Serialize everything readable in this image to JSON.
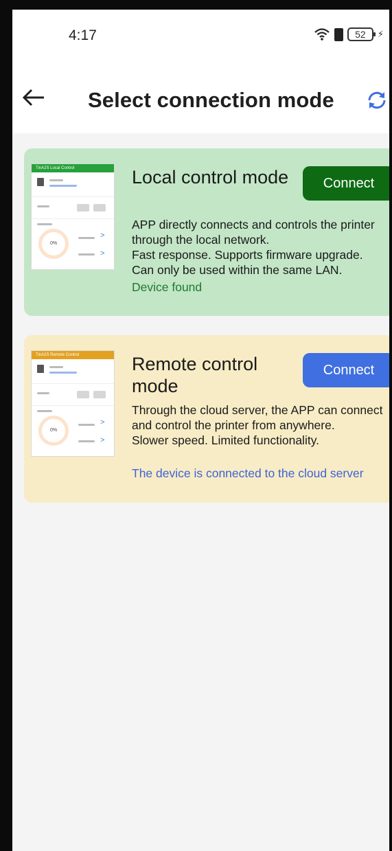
{
  "status_bar": {
    "time": "4:17",
    "battery": "52",
    "icons": [
      "wifi-icon",
      "sim-icon",
      "battery-icon",
      "charging-icon"
    ]
  },
  "header": {
    "back_icon": "arrow-left-icon",
    "title": "Select connection mode",
    "refresh_icon": "refresh-icon"
  },
  "local_mode": {
    "title": "Local control mode",
    "button": "Connect",
    "description": "APP directly connects and controls the printer through the local network.\nFast response. Supports firmware upgrade.\nCan only be used within the same LAN.",
    "status": "Device found",
    "thumbnail_header": "TinA2S Local Control",
    "thumbnail_gauge": "0%",
    "colors": {
      "card": "#c3e6c7",
      "button": "#0e6b14",
      "status": "#1f7a2e"
    }
  },
  "remote_mode": {
    "title": "Remote control mode",
    "button": "Connect",
    "description": "Through the cloud server, the APP can connect and control the printer from anywhere.\nSlower speed. Limited functionality.",
    "status": "The device is connected to the cloud server",
    "thumbnail_header": "TinA2S Remote Control",
    "thumbnail_gauge": "0%",
    "colors": {
      "card": "#f8ecc6",
      "button": "#3f6fe0",
      "status": "#3d63d6"
    }
  }
}
